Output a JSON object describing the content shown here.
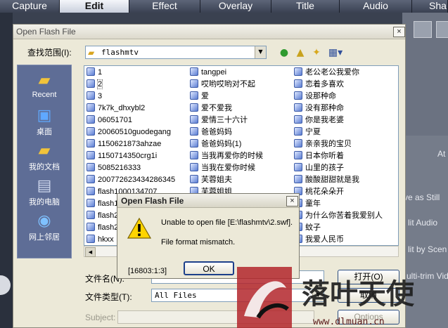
{
  "app_tabs": [
    {
      "label": "Capture",
      "active": false
    },
    {
      "label": "Edit",
      "active": true
    },
    {
      "label": "Effect",
      "active": false
    },
    {
      "label": "Overlay",
      "active": false
    },
    {
      "label": "Title",
      "active": false
    },
    {
      "label": "Audio",
      "active": false
    },
    {
      "label": "Sha",
      "active": false
    }
  ],
  "backdrop": {
    "text_at": "At",
    "text_save_still": "ve as Still",
    "text_split_audio": "lit Audio",
    "text_split_scene": "lit by Scen",
    "text_multi_trim": "ulti-trim Vid"
  },
  "dialog": {
    "title": "Open Flash File",
    "close": "×",
    "look_in_label": "查找范围(I):",
    "look_in_value": "flashmtv",
    "places": [
      "Recent",
      "桌面",
      "我的文档",
      "我的电脑",
      "网上邻居"
    ],
    "files_col1": [
      "1",
      "2",
      "3",
      "7k7k_dhxybl2",
      "06051701",
      "20060510guodegang",
      "1150621873ahzae",
      "1150714350crg1i",
      "5085216333",
      "200772623434286345",
      "flash1000134707",
      "flash1",
      "flash2",
      "flash2",
      "hkxx"
    ],
    "files_col2": [
      "tangpei",
      "哎哟哎哟对不起",
      "爱",
      "爱不爱我",
      "爱情三十六计",
      "爸爸妈妈",
      "爸爸妈妈(1)",
      "当我再爱你的时候",
      "当我在爱你时候",
      "芙蓉姐夫",
      "芙蓉姐姐"
    ],
    "files_col3": [
      "老公老公我爱你",
      "恋着多喜欢",
      "设那种命",
      "没有那种命",
      "你是我老婆",
      "宁夏",
      "亲亲我的宝贝",
      "日本你听着",
      "山里的孩子",
      "酸酸甜甜就是我",
      "桃花朵朵开",
      "童年",
      "为什么你苦着我爱别人",
      "蚊子",
      "我爱人民币"
    ],
    "selected_file": "2",
    "filename_label": "文件名(N):",
    "filetype_label": "文件类型(T):",
    "filetype_value": "All Files",
    "open_button": "打开(O)",
    "cancel_button": "取消",
    "options_button": "Options",
    "subject_label": "Subject:"
  },
  "message_box": {
    "title": "Open Flash File",
    "close": "×",
    "line1": "Unable to open file [E:\\flashmtv\\2.swf].",
    "line2": "File format mismatch.",
    "code": "[16803:1:3]",
    "ok": "OK"
  },
  "watermark": {
    "title": "落叶天使",
    "url": "www.dlmuan.cn"
  }
}
